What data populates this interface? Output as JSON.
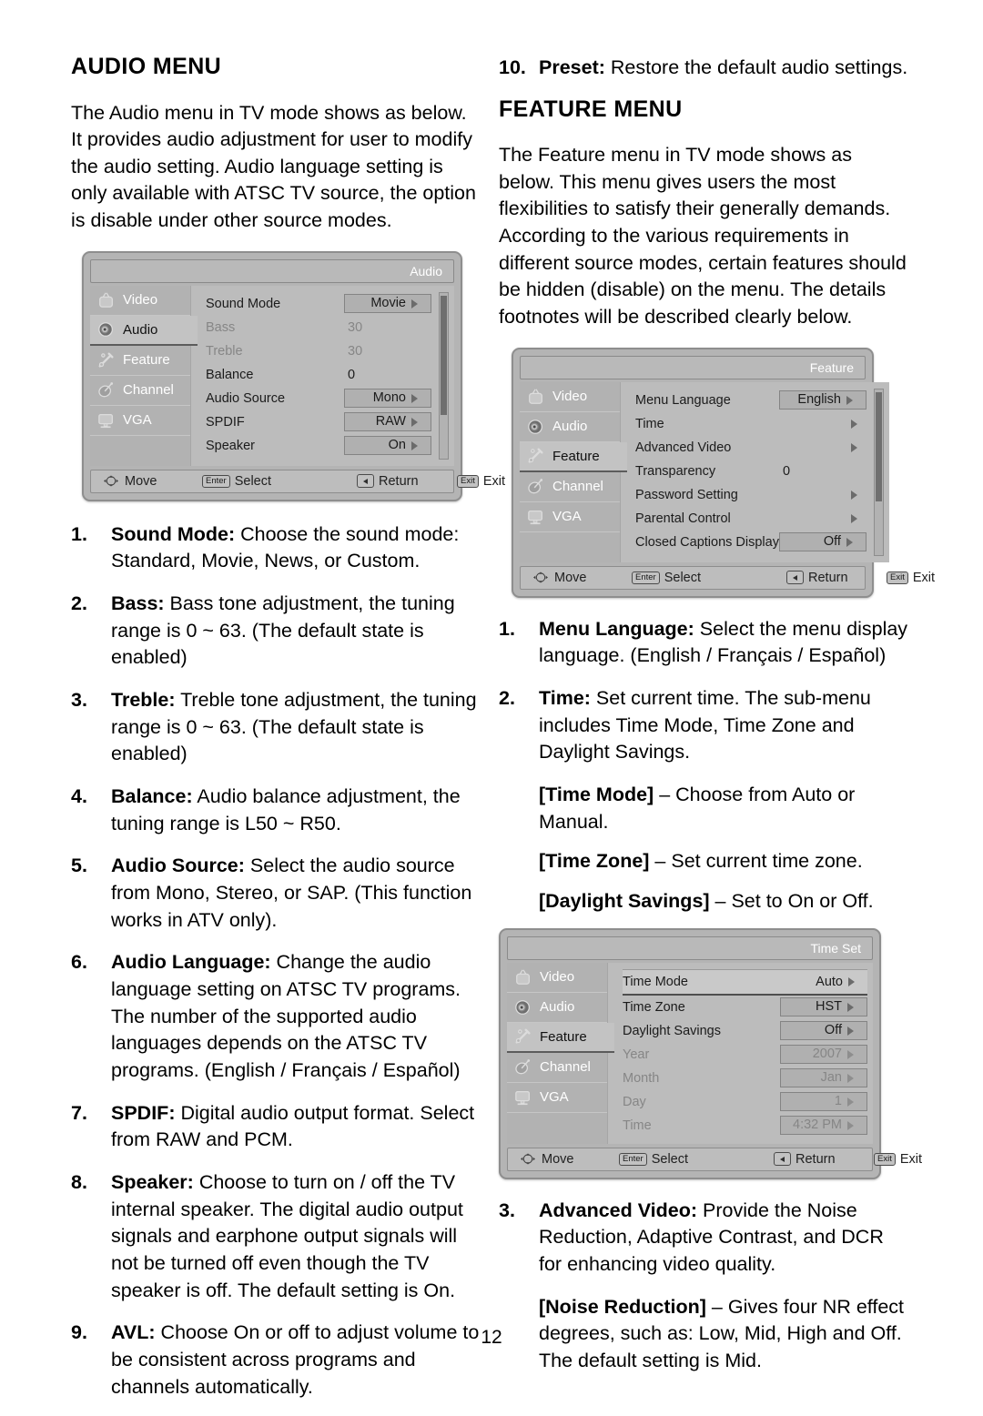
{
  "page": {
    "number": "12"
  },
  "left_column": {
    "title": "AUDIO MENU",
    "intro": "The Audio menu in TV mode shows as below. It provides audio adjustment for user to modify the audio setting. Audio language setting is only available with ATSC TV source, the option is disable under other source modes.",
    "items": [
      {
        "num": "1.",
        "term": "Sound Mode:",
        "text": " Choose the sound mode: Standard, Movie, News, or Custom."
      },
      {
        "num": "2.",
        "term": "Bass:",
        "text": " Bass tone adjustment, the tuning range is 0 ~ 63. (The default state is enabled)"
      },
      {
        "num": "3.",
        "term": "Treble:",
        "text": " Treble tone adjustment, the tuning range is 0 ~ 63. (The default state is enabled)"
      },
      {
        "num": "4.",
        "term": "Balance:",
        "text": " Audio balance adjustment, the tuning range is L50 ~ R50."
      },
      {
        "num": "5.",
        "term": "Audio Source:",
        "text": " Select the audio source from Mono, Stereo, or SAP. (This function works in ATV only)."
      },
      {
        "num": "6.",
        "term": "Audio Language:",
        "text": " Change the audio language setting on ATSC TV programs. The number of the supported audio languages depends on the ATSC TV programs. (English / Français / Español)"
      },
      {
        "num": "7.",
        "term": "SPDIF:",
        "text": " Digital audio output format. Select from RAW and PCM."
      },
      {
        "num": "8.",
        "term": "Speaker:",
        "text": " Choose to turn on / off the TV internal speaker. The digital audio output signals and earphone output signals will not be turned off even though the TV speaker is off. The default setting is On."
      },
      {
        "num": "9.",
        "term": "AVL:",
        "text": " Choose On or off to adjust volume to be consistent across programs and channels automatically."
      }
    ]
  },
  "right_column": {
    "preset_item": {
      "num": "10.",
      "term": "Preset:",
      "text": " Restore the default audio settings."
    },
    "title": "FEATURE MENU",
    "intro": "The Feature menu in TV mode shows as below. This menu gives users the most flexibilities to satisfy their generally demands. According to the various requirements in different source modes, certain features should be hidden (disable) on the menu. The details footnotes will be described clearly below.",
    "items": [
      {
        "num": "1.",
        "term": "Menu Language:",
        "text": " Select the menu display language. (English / Français / Español)"
      },
      {
        "num": "2.",
        "term": "Time:",
        "text": " Set current time. The sub-menu includes Time Mode, Time Zone and Daylight Savings."
      }
    ],
    "time_subnotes": [
      {
        "term": "[Time Mode]",
        "text": " – Choose from Auto or Manual."
      },
      {
        "term": "[Time Zone]",
        "text": " – Set current time zone."
      },
      {
        "term": "[Daylight Savings]",
        "text": " – Set to On or Off."
      }
    ],
    "advanced_item": {
      "num": "3.",
      "term": "Advanced Video:",
      "text": " Provide the Noise Reduction, Adaptive Contrast, and DCR for enhancing video quality."
    },
    "advanced_subnotes": [
      {
        "term": "[Noise Reduction]",
        "text": " – Gives four NR effect degrees, such as: Low, Mid, High and Off. The default setting is Mid."
      }
    ]
  },
  "osd_common": {
    "sidebar": [
      {
        "label": "Video",
        "icon": "tv-icon"
      },
      {
        "label": "Audio",
        "icon": "speaker-icon"
      },
      {
        "label": "Feature",
        "icon": "wrench-icon"
      },
      {
        "label": "Channel",
        "icon": "satellite-dish-icon"
      },
      {
        "label": "VGA",
        "icon": "monitor-icon"
      }
    ],
    "footer": {
      "move": "Move",
      "select_key": "Enter",
      "select": "Select",
      "return": "Return",
      "exit_key": "Exit",
      "exit": "Exit"
    }
  },
  "osd_audio": {
    "title": "Audio",
    "active_index": 1,
    "rows": [
      {
        "label": "Sound Mode",
        "value": "Movie",
        "style": "boxed",
        "dim": false
      },
      {
        "label": "Bass",
        "value": "30",
        "style": "plain",
        "dim": true
      },
      {
        "label": "Treble",
        "value": "30",
        "style": "plain",
        "dim": true
      },
      {
        "label": "Balance",
        "value": "0",
        "style": "plain",
        "dim": false
      },
      {
        "label": "Audio Source",
        "value": "Mono",
        "style": "boxed",
        "dim": false
      },
      {
        "label": "SPDIF",
        "value": "RAW",
        "style": "boxed",
        "dim": false
      },
      {
        "label": "Speaker",
        "value": "On",
        "style": "boxed",
        "dim": false
      }
    ],
    "scroll": {
      "top_pct": 2,
      "height_pct": 72
    }
  },
  "osd_feature": {
    "title": "Feature",
    "active_index": 2,
    "rows": [
      {
        "label": "Menu Language",
        "value": "English",
        "style": "boxed",
        "dim": false
      },
      {
        "label": "Time",
        "value": "",
        "style": "arrow",
        "dim": false
      },
      {
        "label": "Advanced Video",
        "value": "",
        "style": "arrow",
        "dim": false
      },
      {
        "label": "Transparency",
        "value": "0",
        "style": "plain",
        "dim": false
      },
      {
        "label": "Password Setting",
        "value": "",
        "style": "arrow",
        "dim": false
      },
      {
        "label": "Parental Control",
        "value": "",
        "style": "arrow",
        "dim": false
      },
      {
        "label": "Closed Captions Display",
        "value": "Off",
        "style": "boxed",
        "dim": false
      }
    ],
    "scroll": {
      "top_pct": 2,
      "height_pct": 66
    }
  },
  "osd_timeset": {
    "title": "Time Set",
    "active_index": 2,
    "rows": [
      {
        "label": "Time Mode",
        "value": "Auto",
        "style": "highlight",
        "dim": false
      },
      {
        "label": "Time Zone",
        "value": "HST",
        "style": "boxed",
        "dim": false
      },
      {
        "label": "Daylight Savings",
        "value": "Off",
        "style": "boxed",
        "dim": false
      },
      {
        "label": "Year",
        "value": "2007",
        "style": "boxed",
        "dim": true
      },
      {
        "label": "Month",
        "value": "Jan",
        "style": "boxed",
        "dim": true
      },
      {
        "label": "Day",
        "value": "1",
        "style": "boxed",
        "dim": true
      },
      {
        "label": "Time",
        "value": "4:32 PM",
        "style": "boxed",
        "dim": true
      }
    ],
    "scroll": null
  }
}
